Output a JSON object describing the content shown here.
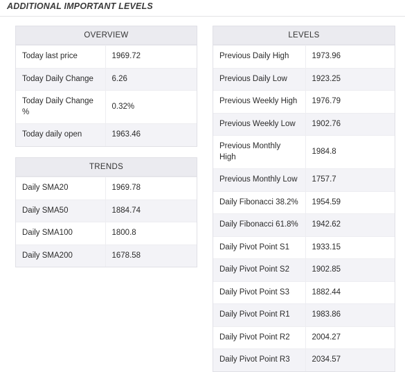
{
  "page": {
    "title": "ADDITIONAL IMPORTANT LEVELS"
  },
  "tables": {
    "overview": {
      "caption": "OVERVIEW",
      "rows": [
        {
          "label": "Today last price",
          "value": "1969.72"
        },
        {
          "label": "Today Daily Change",
          "value": "6.26"
        },
        {
          "label": "Today Daily Change %",
          "value": "0.32%"
        },
        {
          "label": "Today daily open",
          "value": "1963.46"
        }
      ]
    },
    "trends": {
      "caption": "TRENDS",
      "rows": [
        {
          "label": "Daily SMA20",
          "value": "1969.78"
        },
        {
          "label": "Daily SMA50",
          "value": "1884.74"
        },
        {
          "label": "Daily SMA100",
          "value": "1800.8"
        },
        {
          "label": "Daily SMA200",
          "value": "1678.58"
        }
      ]
    },
    "levels": {
      "caption": "LEVELS",
      "rows": [
        {
          "label": "Previous Daily High",
          "value": "1973.96"
        },
        {
          "label": "Previous Daily Low",
          "value": "1923.25"
        },
        {
          "label": "Previous Weekly High",
          "value": "1976.79"
        },
        {
          "label": "Previous Weekly Low",
          "value": "1902.76"
        },
        {
          "label": "Previous Monthly High",
          "value": "1984.8"
        },
        {
          "label": "Previous Monthly Low",
          "value": "1757.7"
        },
        {
          "label": "Daily Fibonacci 38.2%",
          "value": "1954.59"
        },
        {
          "label": "Daily Fibonacci 61.8%",
          "value": "1942.62"
        },
        {
          "label": "Daily Pivot Point S1",
          "value": "1933.15"
        },
        {
          "label": "Daily Pivot Point S2",
          "value": "1902.85"
        },
        {
          "label": "Daily Pivot Point S3",
          "value": "1882.44"
        },
        {
          "label": "Daily Pivot Point R1",
          "value": "1983.86"
        },
        {
          "label": "Daily Pivot Point R2",
          "value": "2004.27"
        },
        {
          "label": "Daily Pivot Point R3",
          "value": "2034.57"
        }
      ]
    }
  },
  "colors": {
    "header_bg": "#ebebf0",
    "row_alt_bg": "#f3f3f7",
    "border": "#e0e0e6",
    "text": "#2b2b2b"
  }
}
